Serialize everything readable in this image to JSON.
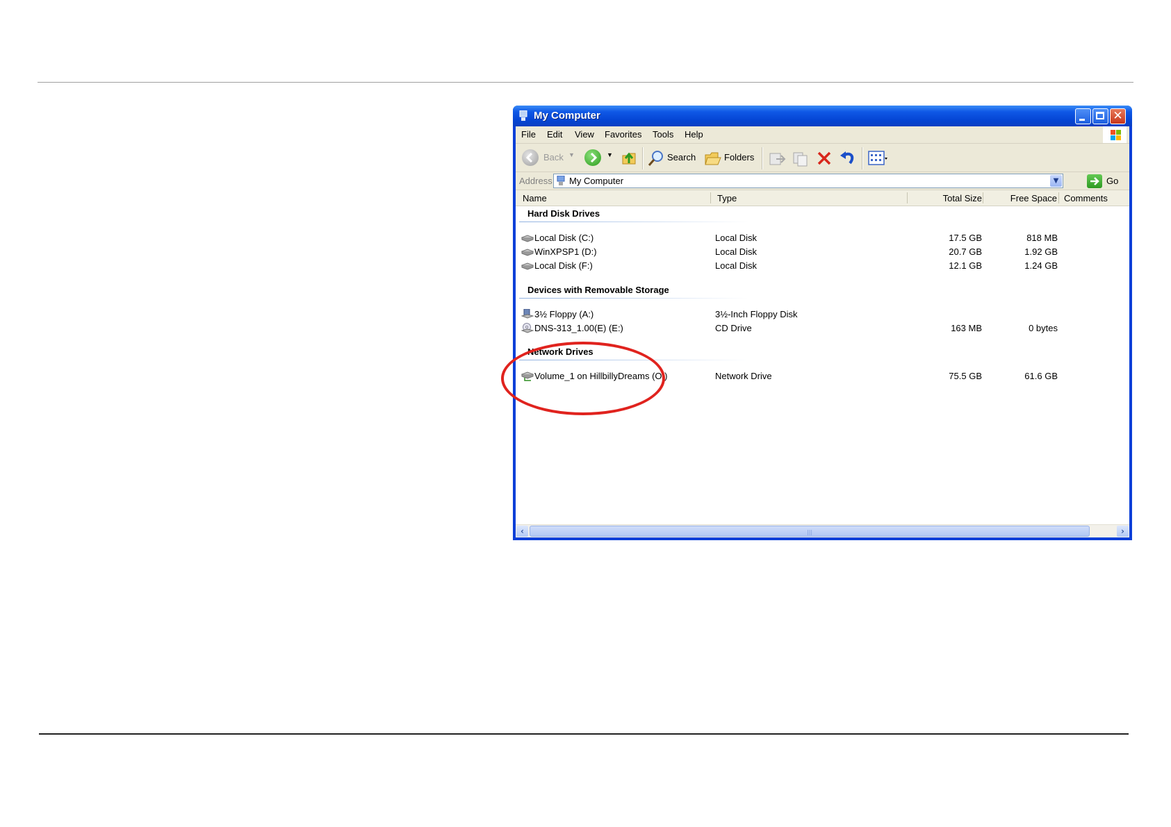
{
  "window": {
    "title": "My Computer"
  },
  "menu": [
    "File",
    "Edit",
    "View",
    "Favorites",
    "Tools",
    "Help"
  ],
  "toolbar": {
    "back_label": "Back",
    "search_label": "Search",
    "folders_label": "Folders"
  },
  "address": {
    "label": "Address",
    "value": "My Computer",
    "go_label": "Go"
  },
  "columns": {
    "name": "Name",
    "type": "Type",
    "total_size": "Total Size",
    "free_space": "Free Space",
    "comments": "Comments"
  },
  "groups": [
    {
      "title": "Hard Disk Drives",
      "items": [
        {
          "name": "Local Disk (C:)",
          "type": "Local Disk",
          "total": "17.5 GB",
          "free": "818 MB",
          "icon": "hard-disk-icon"
        },
        {
          "name": "WinXPSP1 (D:)",
          "type": "Local Disk",
          "total": "20.7 GB",
          "free": "1.92 GB",
          "icon": "hard-disk-icon"
        },
        {
          "name": "Local Disk (F:)",
          "type": "Local Disk",
          "total": "12.1 GB",
          "free": "1.24 GB",
          "icon": "hard-disk-icon"
        }
      ]
    },
    {
      "title": "Devices with Removable Storage",
      "items": [
        {
          "name": "3½ Floppy (A:)",
          "type": "3½-Inch Floppy Disk",
          "total": "",
          "free": "",
          "icon": "floppy-drive-icon"
        },
        {
          "name": "DNS-313_1.00(E) (E:)",
          "type": "CD Drive",
          "total": "163 MB",
          "free": "0 bytes",
          "icon": "cd-drive-icon"
        }
      ]
    },
    {
      "title": "Network Drives",
      "items": [
        {
          "name": "Volume_1 on HillbillyDreams (O:)",
          "type": "Network Drive",
          "total": "75.5 GB",
          "free": "61.6 GB",
          "icon": "network-drive-icon"
        }
      ]
    }
  ],
  "colors": {
    "title_bar": "#0a3fd8",
    "highlight": "#e0231e"
  }
}
